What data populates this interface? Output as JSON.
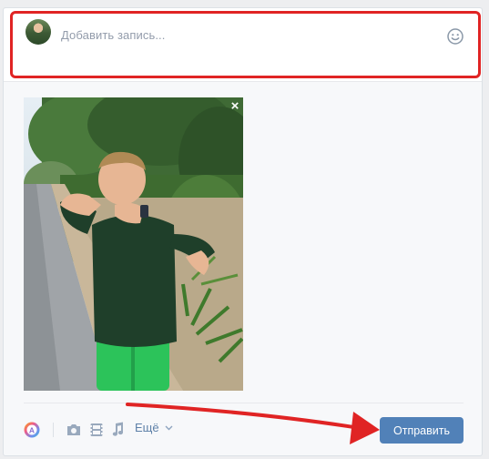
{
  "composer": {
    "placeholder": "Добавить запись...",
    "avatar_icon": "user-avatar",
    "emoji_icon": "smile-icon"
  },
  "attachment": {
    "type": "photo",
    "remove_label": "×"
  },
  "toolbar": {
    "items": [
      {
        "icon": "graffiti-icon"
      },
      {
        "icon": "camera-icon"
      },
      {
        "icon": "video-icon"
      },
      {
        "icon": "music-icon"
      }
    ],
    "more_label": "Ещё",
    "send_label": "Отправить"
  },
  "annotations": {
    "highlight_color": "#e02424",
    "arrow_color": "#e02424"
  },
  "colors": {
    "accent": "#5181b8",
    "link": "#5e81a8",
    "placeholder": "#939cab"
  }
}
